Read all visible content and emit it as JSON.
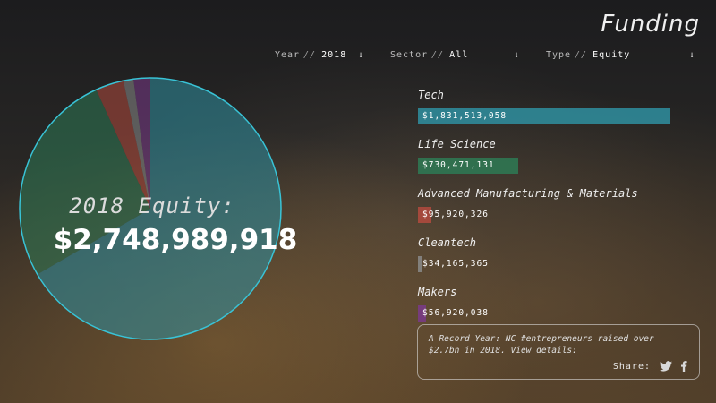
{
  "header": {
    "title": "Funding"
  },
  "filters": [
    {
      "label": "Year",
      "sep": "//",
      "value": "2018"
    },
    {
      "label": "Sector",
      "sep": "//",
      "value": "All"
    },
    {
      "label": "Type",
      "sep": "//",
      "value": "Equity"
    }
  ],
  "summary": {
    "subtitle": "2018 Equity:",
    "total": "$2,748,989,918"
  },
  "sectors": [
    {
      "name": "Tech",
      "amount": "$1,831,513,058",
      "value": 1831513058,
      "color": "#2f8fa0"
    },
    {
      "name": "Life Science",
      "amount": "$730,471,131",
      "value": 730471131,
      "color": "#2e7a55"
    },
    {
      "name": "Advanced Manufacturing & Materials",
      "amount": "$95,920,326",
      "value": 95920326,
      "color": "#b34a3e"
    },
    {
      "name": "Cleantech",
      "amount": "$34,165,365",
      "value": 34165365,
      "color": "#8a8a8a"
    },
    {
      "name": "Makers",
      "amount": "$56,920,038",
      "value": 56920038,
      "color": "#7a3a8a"
    }
  ],
  "share": {
    "text": "A Record Year: NC #entrepreneurs raised over $2.7bn in 2018. View details:",
    "label": "Share:",
    "icons": [
      "twitter-icon",
      "facebook-icon"
    ]
  },
  "chart_data": {
    "type": "pie",
    "categories": [
      "Tech",
      "Life Science",
      "Advanced Manufacturing & Materials",
      "Cleantech",
      "Makers"
    ],
    "values": [
      1831513058,
      730471131,
      95920326,
      34165365,
      56920038
    ],
    "colors": [
      "#2f8fa0",
      "#2e7a55",
      "#b34a3e",
      "#8a8a8a",
      "#7a3a8a"
    ]
  }
}
